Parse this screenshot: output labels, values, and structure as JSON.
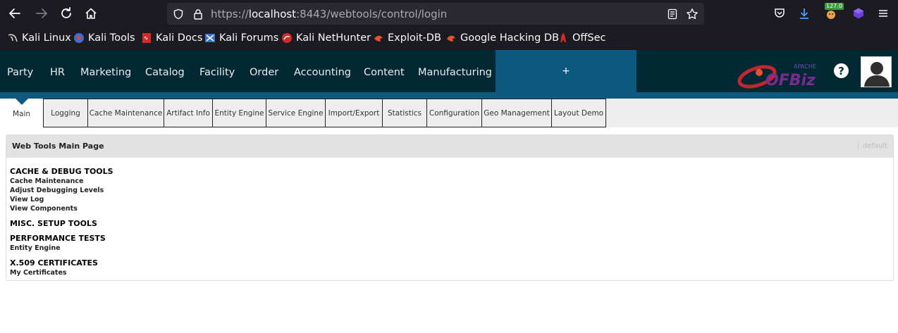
{
  "browser": {
    "url_prefix": "https://",
    "url_host": "localhost",
    "url_rest": ":8443/webtools/control/login",
    "extension_badge": "127.0"
  },
  "bookmarks": [
    {
      "label": "Kali Linux",
      "icon": "kali-dragon-icon"
    },
    {
      "label": "Kali Tools",
      "icon": "kali-tools-icon"
    },
    {
      "label": "Kali Docs",
      "icon": "kali-docs-icon"
    },
    {
      "label": "Kali Forums",
      "icon": "kali-forums-icon"
    },
    {
      "label": "Kali NetHunter",
      "icon": "nethunter-icon"
    },
    {
      "label": "Exploit-DB",
      "icon": "exploit-db-icon"
    },
    {
      "label": "Google Hacking DB",
      "icon": "ghdb-icon"
    },
    {
      "label": "OffSec",
      "icon": "offsec-icon"
    }
  ],
  "app_nav": [
    "Party",
    "HR",
    "Marketing",
    "Catalog",
    "Facility",
    "Order",
    "Accounting",
    "Content",
    "Manufacturing"
  ],
  "plus_label": "+",
  "logo": {
    "small": "APACHE",
    "big": "OFBiz"
  },
  "help_label": "?",
  "tabs": {
    "main": "Main",
    "items": [
      "Logging",
      "Cache Maintenance",
      "Artifact Info",
      "Entity Engine",
      "Service Engine",
      "Import/Export",
      "Statistics",
      "Configuration",
      "Geo Management",
      "Layout Demo"
    ]
  },
  "panel": {
    "title": "Web Tools Main Page",
    "default_label": "default",
    "sections": [
      {
        "title": "CACHE & DEBUG TOOLS",
        "links": [
          "Cache Maintenance",
          "Adjust Debugging Levels",
          "View Log",
          "View Components"
        ]
      },
      {
        "title": "MISC. SETUP TOOLS",
        "links": []
      },
      {
        "title": "PERFORMANCE TESTS",
        "links": [
          "Entity Engine"
        ]
      },
      {
        "title": "X.509 CERTIFICATES",
        "links": [
          "My Certificates"
        ]
      }
    ]
  },
  "colors": {
    "header_bg": "#022833",
    "accent_blue": "#0d5980",
    "browser_bg": "#1c1b22"
  }
}
